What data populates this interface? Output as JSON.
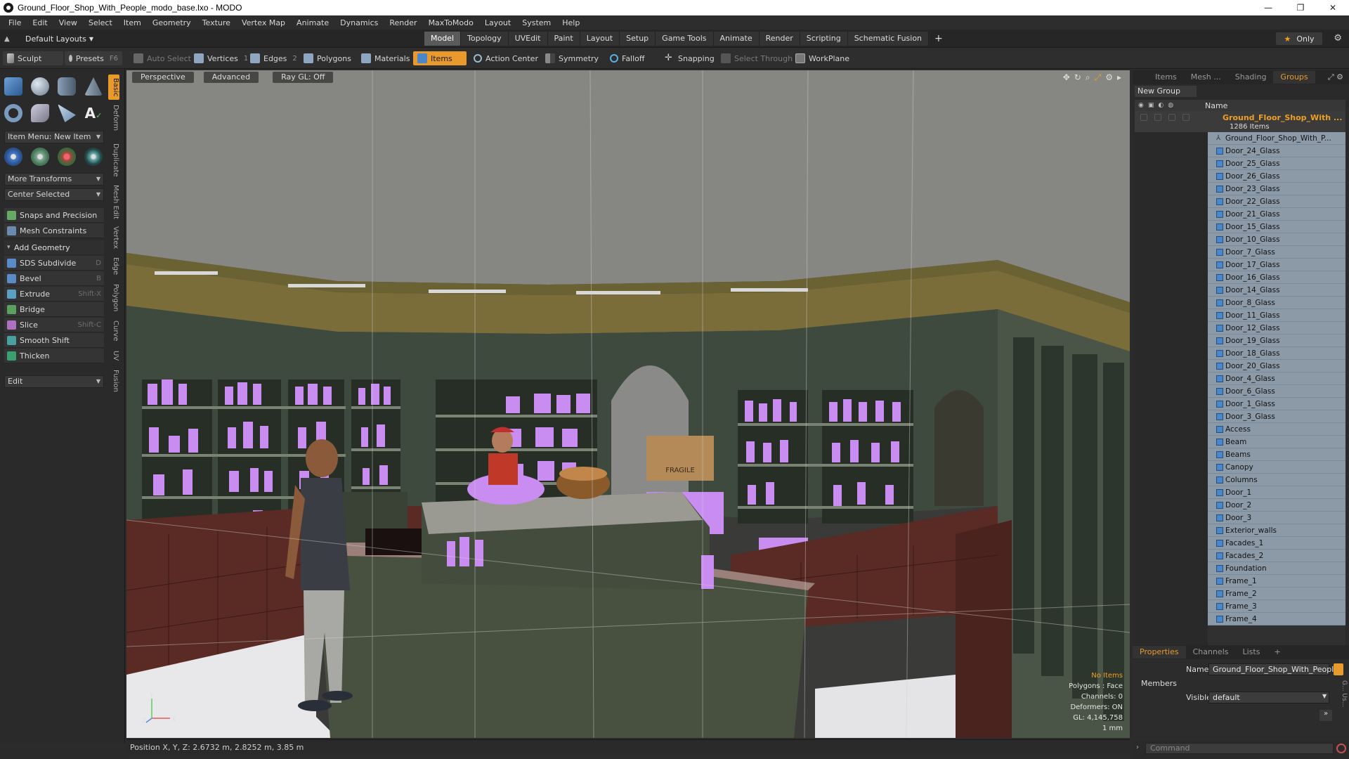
{
  "window": {
    "title": "Ground_Floor_Shop_With_People_modo_base.lxo - MODO",
    "controls": [
      "—",
      "❐",
      "✕"
    ]
  },
  "menu": [
    "File",
    "Edit",
    "View",
    "Select",
    "Item",
    "Geometry",
    "Texture",
    "Vertex Map",
    "Animate",
    "Dynamics",
    "Render",
    "MaxToModo",
    "Layout",
    "System",
    "Help"
  ],
  "layout_bar": {
    "layout_select": "Default Layouts",
    "tabs": [
      "Model",
      "Topology",
      "UVEdit",
      "Paint",
      "Layout",
      "Setup",
      "Game Tools",
      "Animate",
      "Render",
      "Scripting",
      "Schematic Fusion"
    ],
    "active_tab": "Model",
    "only_label": "Only"
  },
  "toolbar": {
    "sculpt": "Sculpt",
    "presets": "Presets",
    "presets_shortcut": "F6",
    "auto_select": "Auto Select",
    "vertices": "Vertices",
    "vertices_num": "1",
    "edges": "Edges",
    "edges_num": "2",
    "polygons": "Polygons",
    "materials": "Materials",
    "items": "Items",
    "action_center": "Action Center",
    "symmetry": "Symmetry",
    "falloff": "Falloff",
    "snapping": "Snapping",
    "select_through": "Select Through",
    "workplane": "WorkPlane"
  },
  "left_panel": {
    "item_menu": "Item Menu: New Item",
    "more_transforms": "More Transforms",
    "center_selected": "Center Selected",
    "snaps": "Snaps and Precision",
    "mesh_constraints": "Mesh Constraints",
    "add_geometry": "Add Geometry",
    "tools": [
      {
        "label": "SDS Subdivide",
        "shortcut": "D"
      },
      {
        "label": "Bevel",
        "shortcut": "B"
      },
      {
        "label": "Extrude",
        "shortcut": "Shift-X"
      },
      {
        "label": "Bridge",
        "shortcut": ""
      },
      {
        "label": "Slice",
        "shortcut": "Shift-C"
      },
      {
        "label": "Smooth Shift",
        "shortcut": ""
      },
      {
        "label": "Thicken",
        "shortcut": ""
      }
    ],
    "edit": "Edit",
    "vertical_tabs": [
      "Basic",
      "Deform",
      "Duplicate",
      "Mesh Edit",
      "Vertex",
      "Edge",
      "Polygon",
      "Curve",
      "UV",
      "Fusion"
    ]
  },
  "viewport": {
    "perspective": "Perspective",
    "advanced": "Advanced",
    "raygl": "Ray GL: Off",
    "info": {
      "no_items": "No Items",
      "polygons": "Polygons : Face",
      "channels": "Channels: 0",
      "deformers": "Deformers: ON",
      "gl": "GL: 4,145,758",
      "unit": "1 mm"
    },
    "axis": {
      "y": "Y",
      "z": "Z",
      "x": "X"
    },
    "scene": {
      "box_label": "FRAGILE"
    }
  },
  "status": {
    "position": "Position X, Y, Z:   2.6732 m, 2.8252 m, 3.85 m"
  },
  "right_panel": {
    "tabs": [
      "Items",
      "Mesh ...",
      "Shading",
      "Groups"
    ],
    "active_tab": "Groups",
    "new_group": "New Group",
    "name_header": "Name",
    "group_name": "Ground_Floor_Shop_With ...",
    "group_count": "1286 Items",
    "items": [
      "Ground_Floor_Shop_With_P...",
      "Door_24_Glass",
      "Door_25_Glass",
      "Door_26_Glass",
      "Door_23_Glass",
      "Door_22_Glass",
      "Door_21_Glass",
      "Door_15_Glass",
      "Door_10_Glass",
      "Door_7_Glass",
      "Door_17_Glass",
      "Door_16_Glass",
      "Door_14_Glass",
      "Door_8_Glass",
      "Door_11_Glass",
      "Door_12_Glass",
      "Door_19_Glass",
      "Door_18_Glass",
      "Door_20_Glass",
      "Door_4_Glass",
      "Door_6_Glass",
      "Door_1_Glass",
      "Door_3_Glass",
      "Access",
      "Beam",
      "Beams",
      "Canopy",
      "Columns",
      "Door_1",
      "Door_2",
      "Door_3",
      "Exterior_walls",
      "Facades_1",
      "Facades_2",
      "Foundation",
      "Frame_1",
      "Frame_2",
      "Frame_3",
      "Frame_4"
    ]
  },
  "properties": {
    "tabs": [
      "Properties",
      "Channels",
      "Lists"
    ],
    "active_tab": "Properties",
    "name_label": "Name",
    "name_value": "Ground_Floor_Shop_With_People",
    "members": "Members",
    "visible_label": "Visible",
    "visible_value": "default",
    "side_tabs": "G... Us..."
  },
  "command": {
    "placeholder": "Command"
  },
  "colors": {
    "accent": "#e89a2c",
    "wall": "#3e4a3e",
    "drawers": "#5a2a24",
    "glass_bottles": "#c98cf0",
    "floor": "#e8e8ea",
    "ceiling": "#858580",
    "beam": "#6b6234"
  }
}
